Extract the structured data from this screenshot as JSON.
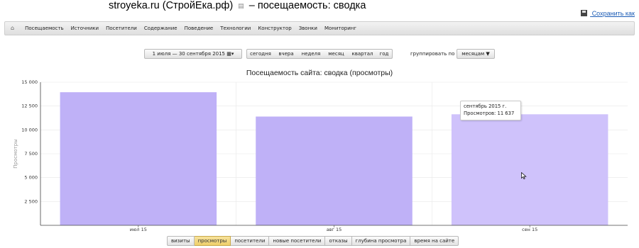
{
  "header": {
    "title_main": "stroyeka.ru (СтройЕка.рф)",
    "title_suffix": "– посещаемость: сводка",
    "save_label": "Сохранить как"
  },
  "nav": {
    "items": [
      "Посещаемость",
      "Источники",
      "Посетители",
      "Содержание",
      "Поведение",
      "Технологии",
      "Конструктор",
      "Звонки",
      "Мониторинг"
    ],
    "active_index": 0
  },
  "controls": {
    "date_range": "1 июля — 30 сентября 2015",
    "periods": [
      "сегодня",
      "вчера",
      "неделя",
      "месяц",
      "квартал",
      "год"
    ],
    "group_by_label": "группировать по",
    "group_by_value": "месяцам ▼"
  },
  "tooltip": {
    "line1": "сентябрь 2015 г.",
    "line2": "Просмотров: 11 637"
  },
  "metric_tabs": {
    "items": [
      "визиты",
      "просмотры",
      "посетители",
      "новые посетители",
      "отказы",
      "глубина просмотра",
      "время на сайте"
    ],
    "active_index": 1
  },
  "colors": {
    "bar": "#bfb1f7",
    "bar_highlight": "#cfc2fb",
    "axis": "#444444",
    "grid": "#e8e8e8",
    "tab_active": "#f0d57a"
  },
  "chart_data": {
    "type": "bar",
    "title": "Посещаемость сайта: сводка (просмотры)",
    "ylabel": "Просмотры",
    "xlabel": "",
    "categories": [
      "июл 15",
      "авг 15",
      "сен 15"
    ],
    "values": [
      13950,
      11400,
      11637
    ],
    "ylim": [
      0,
      15000
    ],
    "yticks": [
      2500,
      5000,
      7500,
      10000,
      12500,
      15000
    ],
    "ytick_labels": [
      "2 500",
      "5 000",
      "7 500",
      "10 000",
      "12 500",
      "15 000"
    ],
    "grid": true,
    "highlighted_index": 2
  }
}
